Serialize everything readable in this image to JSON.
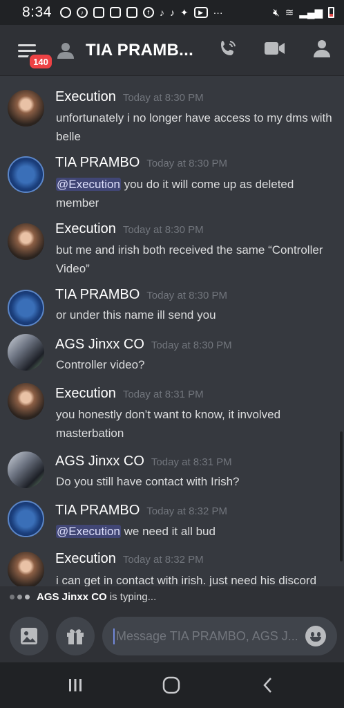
{
  "status_bar": {
    "time": "8:34"
  },
  "header": {
    "notification_count": "140",
    "title": "TIA PRAMB..."
  },
  "messages": [
    {
      "author": "Execution",
      "time": "Today at 8:30 PM",
      "text": "unfortunately i no longer have access to my dms with belle",
      "avatar": "execution-avatar"
    },
    {
      "author": "TIA PRAMBO",
      "time": "Today at 8:30 PM",
      "mention": "@Execution",
      "text": " you do it will come up as deleted member",
      "avatar": "tia-prambo-avatar"
    },
    {
      "author": "Execution",
      "time": "Today at 8:30 PM",
      "text": "but me and irish both received the same “Controller Video”",
      "avatar": "execution-avatar"
    },
    {
      "author": "TIA PRAMBO",
      "time": "Today at 8:30 PM",
      "text": "or under this name ill send you",
      "avatar": "tia-prambo-avatar"
    },
    {
      "author": "AGS Jinxx CO",
      "time": "Today at 8:30 PM",
      "text": "Controller video?",
      "avatar": "ags-jinxx-avatar"
    },
    {
      "author": "Execution",
      "time": "Today at 8:31 PM",
      "text": "you honestly don’t want to know, it involved masterbation",
      "avatar": "execution-avatar"
    },
    {
      "author": "AGS Jinxx CO",
      "time": "Today at 8:31 PM",
      "text": "Do you still have contact with Irish?",
      "avatar": "ags-jinxx-avatar"
    },
    {
      "author": "TIA PRAMBO",
      "time": "Today at 8:32 PM",
      "mention": "@Execution",
      "text": " we need it all bud",
      "avatar": "tia-prambo-avatar"
    },
    {
      "author": "Execution",
      "time": "Today at 8:32 PM",
      "text": "i can get in contact with irish. just need his discord",
      "avatar": "execution-avatar"
    }
  ],
  "typing": {
    "user": "AGS Jinxx CO",
    "suffix": "is typing..."
  },
  "composer": {
    "placeholder": "Message TIA PRAMBO, AGS J..."
  },
  "colors": {
    "background": "#36393f",
    "header": "#2f3136",
    "mention_bg": "#414675",
    "badge": "#ed4245",
    "timestamp": "#72767d"
  }
}
